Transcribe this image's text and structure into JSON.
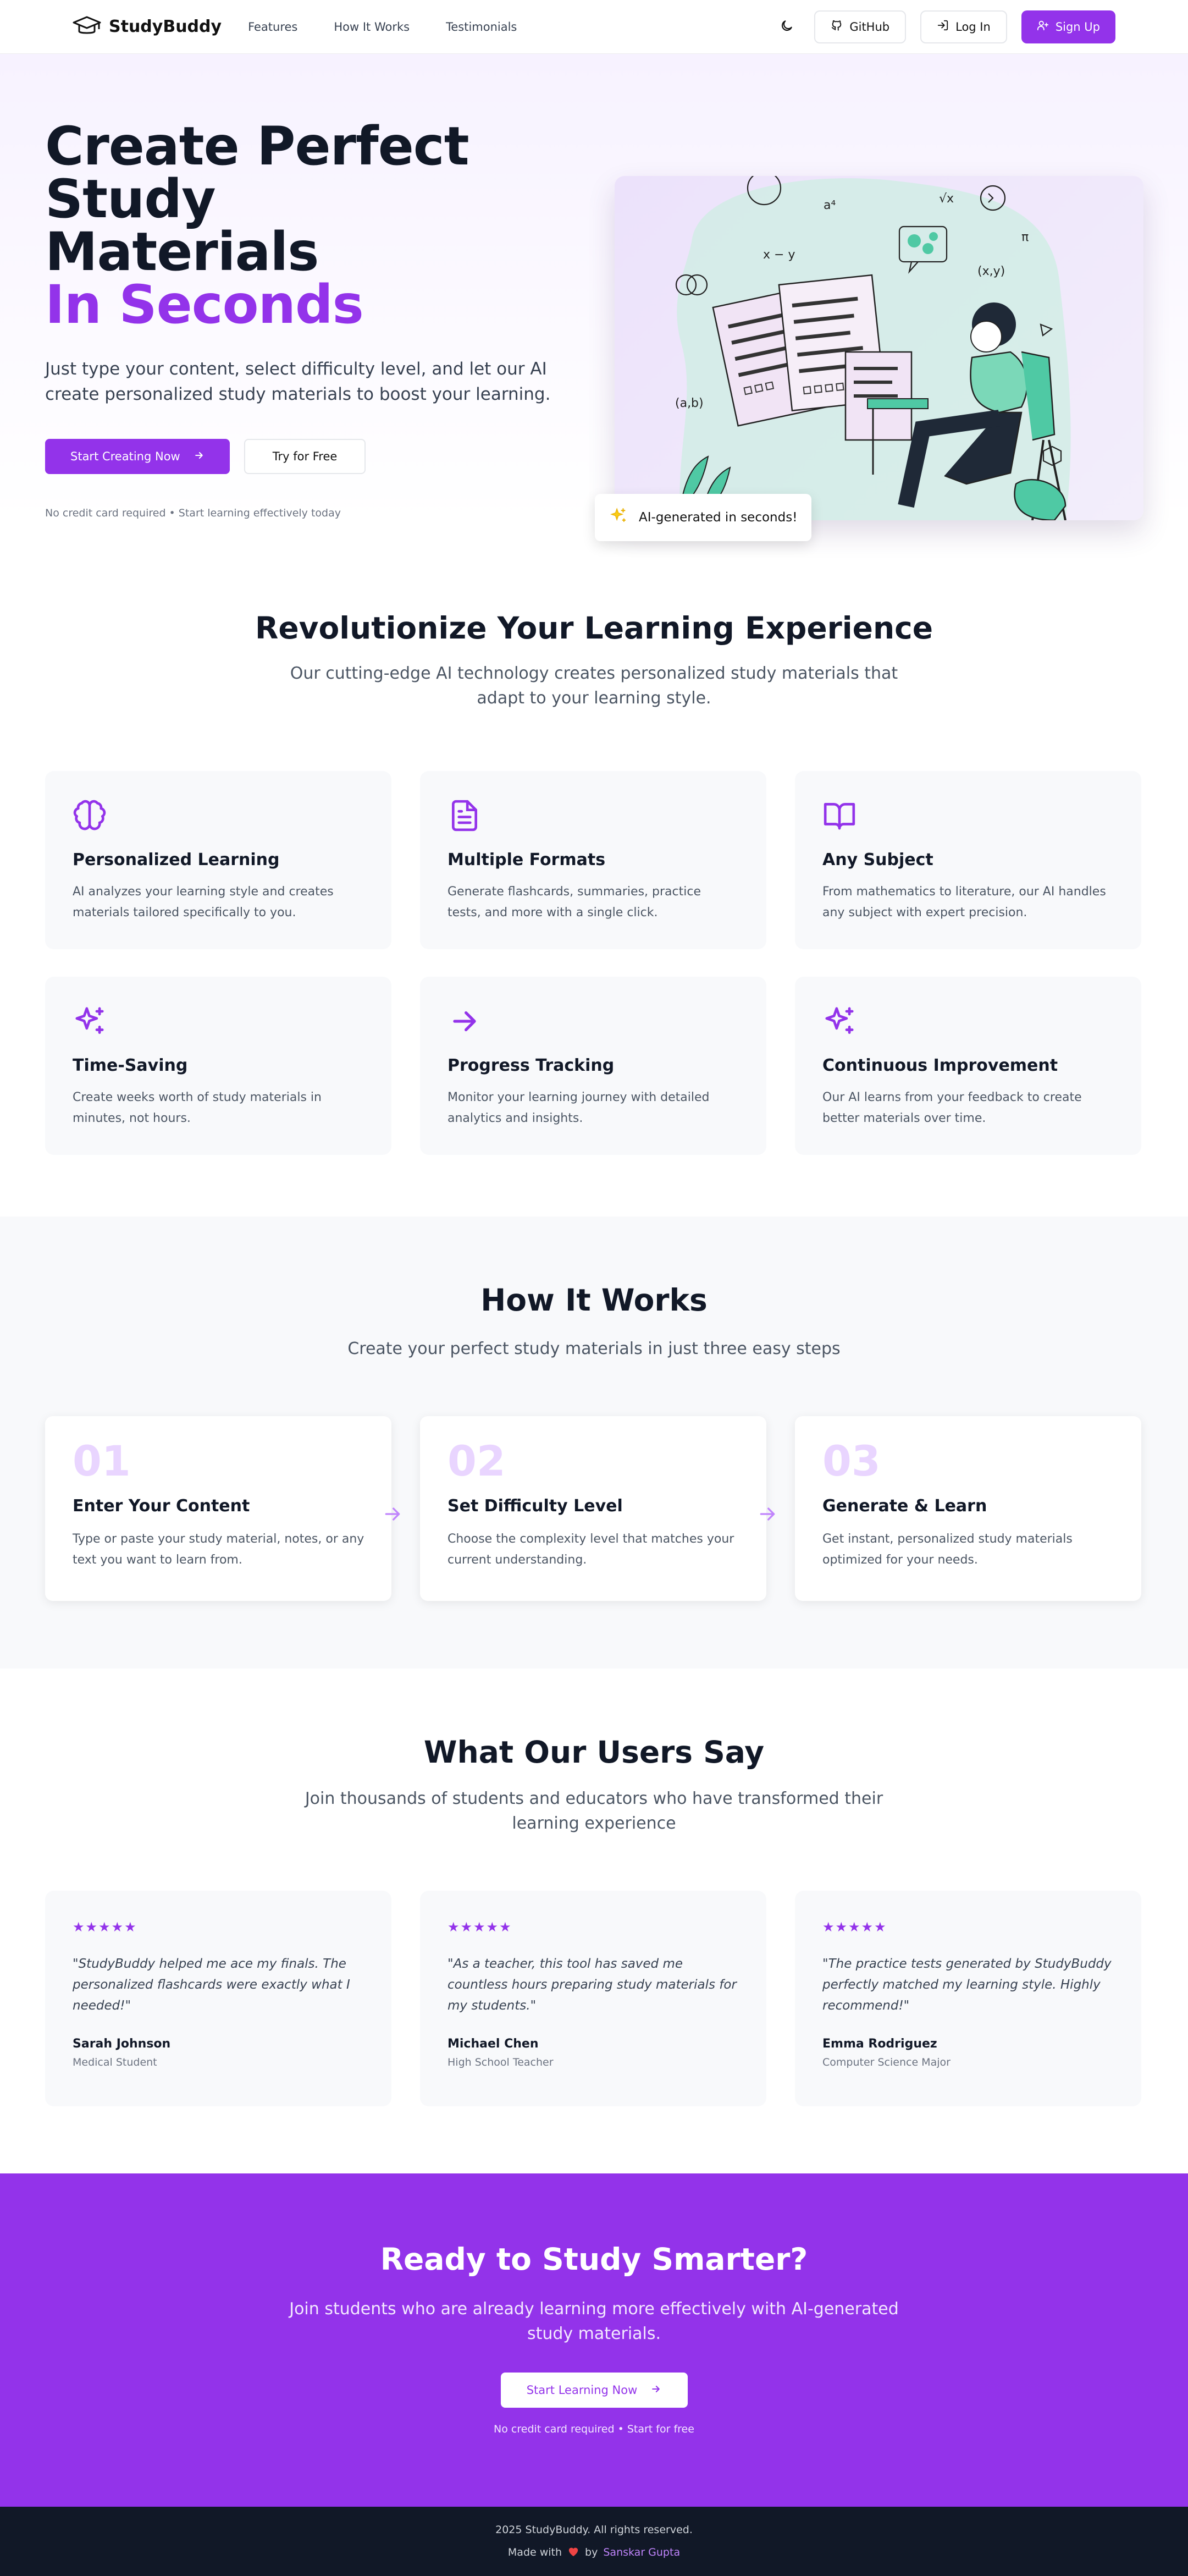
{
  "nav": {
    "brand": "StudyBuddy",
    "links": [
      "Features",
      "How It Works",
      "Testimonials"
    ],
    "github": "GitHub",
    "login": "Log In",
    "signup": "Sign Up"
  },
  "hero": {
    "title_line1": "Create Perfect Study",
    "title_line2": "Materials",
    "title_accent": "In Seconds",
    "subtitle": "Just type your content, select difficulty level, and let our AI create personalized study materials to boost your learning.",
    "primary_cta": "Start Creating Now",
    "secondary_cta": "Try for Free",
    "note": "No credit card required • Start learning effectively today",
    "badge": "AI-generated in seconds!"
  },
  "features": {
    "title": "Revolutionize Your Learning Experience",
    "subtitle": "Our cutting-edge AI technology creates personalized study materials that adapt to your learning style.",
    "items": [
      {
        "icon": "brain-icon",
        "title": "Personalized Learning",
        "desc": "AI analyzes your learning style and creates materials tailored specifically to you."
      },
      {
        "icon": "document-icon",
        "title": "Multiple Formats",
        "desc": "Generate flashcards, summaries, practice tests, and more with a single click."
      },
      {
        "icon": "book-open-icon",
        "title": "Any Subject",
        "desc": "From mathematics to literature, our AI handles any subject with expert precision."
      },
      {
        "icon": "sparkles-icon",
        "title": "Time-Saving",
        "desc": "Create weeks worth of study materials in minutes, not hours."
      },
      {
        "icon": "arrow-right-icon",
        "title": "Progress Tracking",
        "desc": "Monitor your learning journey with detailed analytics and insights."
      },
      {
        "icon": "sparkles-icon",
        "title": "Continuous Improvement",
        "desc": "Our AI learns from your feedback to create better materials over time."
      }
    ]
  },
  "how": {
    "title": "How It Works",
    "subtitle": "Create your perfect study materials in just three easy steps",
    "steps": [
      {
        "num": "01",
        "title": "Enter Your Content",
        "desc": "Type or paste your study material, notes, or any text you want to learn from."
      },
      {
        "num": "02",
        "title": "Set Difficulty Level",
        "desc": "Choose the complexity level that matches your current understanding."
      },
      {
        "num": "03",
        "title": "Generate & Learn",
        "desc": "Get instant, personalized study materials optimized for your needs."
      }
    ]
  },
  "testimonials": {
    "title": "What Our Users Say",
    "subtitle": "Join thousands of students and educators who have transformed their learning experience",
    "stars": "★★★★★",
    "items": [
      {
        "quote": "\"StudyBuddy helped me ace my finals. The personalized flashcards were exactly what I needed!\"",
        "name": "Sarah Johnson",
        "role": "Medical Student"
      },
      {
        "quote": "\"As a teacher, this tool has saved me countless hours preparing study materials for my students.\"",
        "name": "Michael Chen",
        "role": "High School Teacher"
      },
      {
        "quote": "\"The practice tests generated by StudyBuddy perfectly matched my learning style. Highly recommend!\"",
        "name": "Emma Rodriguez",
        "role": "Computer Science Major"
      }
    ]
  },
  "cta": {
    "title": "Ready to Study Smarter?",
    "subtitle": "Join students who are already learning more effectively with AI-generated study materials.",
    "button": "Start Learning Now",
    "note": "No credit card required • Start for free"
  },
  "footer": {
    "copyright": "2025 StudyBuddy. All rights reserved.",
    "made_with": "Made with",
    "by": "by",
    "author": "Sanskar Gupta"
  },
  "colors": {
    "accent": "#9333ea",
    "accent_light": "#e9d5ff",
    "dark": "#111827",
    "card_bg": "#f8f9fb"
  }
}
